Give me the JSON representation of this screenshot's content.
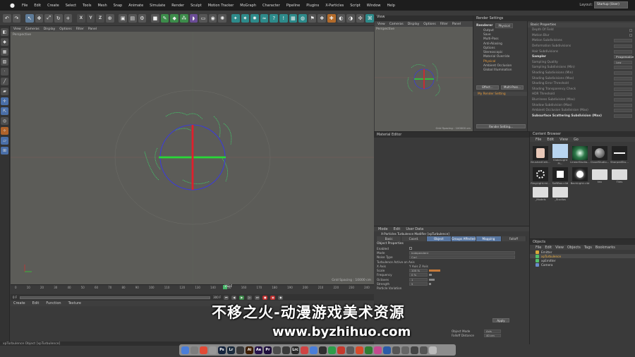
{
  "menubar": {
    "items": [
      "File",
      "Edit",
      "Create",
      "Select",
      "Tools",
      "Mesh",
      "Snap",
      "Animate",
      "Simulate",
      "Render",
      "Sculpt",
      "Motion Tracker",
      "MoGraph",
      "Character",
      "Pipeline",
      "Plugins",
      "X-Particles",
      "Script",
      "Window",
      "Help"
    ],
    "layout_label": "Layout:",
    "layout_value": "Startup (User)"
  },
  "viewport_main": {
    "menu": [
      "View",
      "Cameras",
      "Display",
      "Options",
      "Filter",
      "Panel"
    ],
    "label": "Perspective",
    "grid_spacing": "Grid Spacing : 10000 cm"
  },
  "viewport_small": {
    "menu": [
      "View",
      "Cameras",
      "Display",
      "Options",
      "Filter",
      "Panel"
    ],
    "label": "Perspective",
    "grid_spacing": "Grid Spacing : 100000 cm"
  },
  "render_settings": {
    "title": "Render Settings",
    "renderer_label": "Renderer",
    "renderer_value": "Physical",
    "items": [
      "Output",
      "Save",
      "Multi-Pass",
      "Anti-Aliasing",
      "Options",
      "Stereoscopic",
      "Material Override",
      "Physical",
      "Ambient Occlusion",
      "Global Illumination"
    ],
    "effect_button": "Effect...",
    "multipass_button": "Multi-Pass...",
    "my_setting": "My Render Setting",
    "render_setting_button": "Render Setting...",
    "props_title": "Basic Properties",
    "props": [
      {
        "label": "Depth Of Field",
        "value": ""
      },
      {
        "label": "Motion Blur",
        "value": ""
      },
      {
        "label": "Motion Subdivisions",
        "value": ""
      },
      {
        "label": "Deformation Subdivisions",
        "value": ""
      },
      {
        "label": "Hair Subdivisions",
        "value": ""
      },
      {
        "label": "Sampler",
        "value": "Progressive"
      },
      {
        "label": "Sampling Quality",
        "value": "Low"
      },
      {
        "label": "Sampling Subdivisions (Min)",
        "value": ""
      },
      {
        "label": "Shading Subdivisions (Min)",
        "value": ""
      },
      {
        "label": "Shading Subdivisions (Max)",
        "value": ""
      },
      {
        "label": "Shading Error Threshold",
        "value": ""
      },
      {
        "label": "Shading Transparency Check",
        "value": ""
      },
      {
        "label": "HDR Threshold",
        "value": ""
      },
      {
        "label": "Blurriness Subdivision (Max)",
        "value": ""
      },
      {
        "label": "Shadow Subdivision (Max)",
        "value": ""
      },
      {
        "label": "Ambient Occlusion Subdivision (Max)",
        "value": ""
      },
      {
        "label": "Subsurface Scattering Subdivision (Max)",
        "value": ""
      }
    ]
  },
  "material_editor": {
    "title": "Material Editor"
  },
  "content_browser": {
    "title": "Content Browser",
    "menu": [
      "File",
      "Edit",
      "View",
      "Go"
    ],
    "thumbs": [
      "BrushedCeili...",
      "GlobeLight Pi...",
      "LinearStudio...",
      "CloudStudio...",
      "SharpedStu...",
      "RingLight.mi...",
      "SoftBox.c4d",
      "BackLight.c4d",
      "tex",
      "Tiles",
      "_Models",
      "_Studios"
    ]
  },
  "attribute_manager": {
    "menu": [
      "Mode",
      "Edit",
      "User Data"
    ],
    "title": "X-Particles Turbulence Modifier [xpTurbulence]",
    "tabs": [
      "Basic",
      "Coord.",
      "Object",
      "Groups Affected",
      "Mapping",
      "Falloff"
    ],
    "section": "Object Properties",
    "rows": [
      {
        "label": "Enabled",
        "value": ""
      },
      {
        "label": "Mode",
        "value": "Independent"
      },
      {
        "label": "Noise Type",
        "value": "Curl"
      },
      {
        "label": "Turbulence Active on Axis",
        "value": ""
      },
      {
        "label": "X Axis",
        "value": "Y Axis   Z Axis"
      },
      {
        "label": "Scale",
        "value": "100 %"
      },
      {
        "label": "Frequency",
        "value": "0 %"
      },
      {
        "label": "Octaves",
        "value": "1"
      },
      {
        "label": "Strength",
        "value": "5"
      },
      {
        "label": "Particle Variation",
        "value": ""
      }
    ],
    "lower": [
      {
        "label": "Object Mode",
        "value": "Axis"
      },
      {
        "label": "Falloff Distance",
        "value": "40 cm"
      }
    ],
    "apply": "Apply"
  },
  "objects": {
    "title": "Objects",
    "menu": [
      "File",
      "Edit",
      "View",
      "Objects",
      "Tags",
      "Bookmarks"
    ],
    "rows": [
      {
        "name": "Emitter",
        "color": "#d8a83a"
      },
      {
        "name": "xpTurbulence",
        "color": "#53c06a"
      },
      {
        "name": "xpEmitter",
        "color": "#53c06a"
      },
      {
        "name": "Camera",
        "color": "#6a8ccc"
      }
    ]
  },
  "timeline": {
    "ticks": [
      "0",
      "10",
      "20",
      "30",
      "40",
      "50",
      "60",
      "70",
      "80",
      "90",
      "100",
      "110",
      "120",
      "130",
      "140",
      "150",
      "160",
      "170",
      "180",
      "190",
      "200",
      "210",
      "220",
      "230",
      "240"
    ],
    "frame_start": "0 F",
    "frame_end": "300 F",
    "current": "153 F"
  },
  "material_bar": {
    "items": [
      "Create",
      "Edit",
      "Function",
      "Texture"
    ]
  },
  "status": {
    "text": "xpTurbulence Object [xpTurbulence]"
  },
  "watermark": {
    "cn": "不移之火-动漫游戏美术资源",
    "url": "www.byzhihuo.com"
  },
  "dock": {
    "apps": [
      {
        "t": "",
        "c": "#4a7ed9"
      },
      {
        "t": "",
        "c": "#7e7e7e"
      },
      {
        "t": "",
        "c": "#e24a36"
      },
      {
        "t": "",
        "c": "#999999"
      },
      {
        "t": "Ps",
        "c": "#15243d"
      },
      {
        "t": "Lr",
        "c": "#1c2c3d"
      },
      {
        "t": "",
        "c": "#3a3a3a"
      },
      {
        "t": "Ai",
        "c": "#3d1d00"
      },
      {
        "t": "Ae",
        "c": "#26124a"
      },
      {
        "t": "Pr",
        "c": "#1d0d3a"
      },
      {
        "t": "",
        "c": "#4c4c4c"
      },
      {
        "t": "",
        "c": "#3a3a3a"
      },
      {
        "t": "Lrc",
        "c": "#2a2a2a"
      },
      {
        "t": "",
        "c": "#d04343"
      },
      {
        "t": "",
        "c": "#4a7ed9"
      },
      {
        "t": "",
        "c": "#2f2f2f"
      },
      {
        "t": "",
        "c": "#2c9e4a"
      },
      {
        "t": "",
        "c": "#c6392d"
      },
      {
        "t": "",
        "c": "#5a5a5a"
      },
      {
        "t": "",
        "c": "#d84a2a"
      },
      {
        "t": "",
        "c": "#2e7d32"
      },
      {
        "t": "",
        "c": "#c44a90"
      },
      {
        "t": "",
        "c": "#2a5ba8"
      },
      {
        "t": "",
        "c": "#555555"
      },
      {
        "t": "",
        "c": "#666666"
      },
      {
        "t": "",
        "c": "#444444"
      },
      {
        "t": "",
        "c": "#555555"
      },
      {
        "t": "",
        "c": "#bbbbbb"
      }
    ]
  }
}
